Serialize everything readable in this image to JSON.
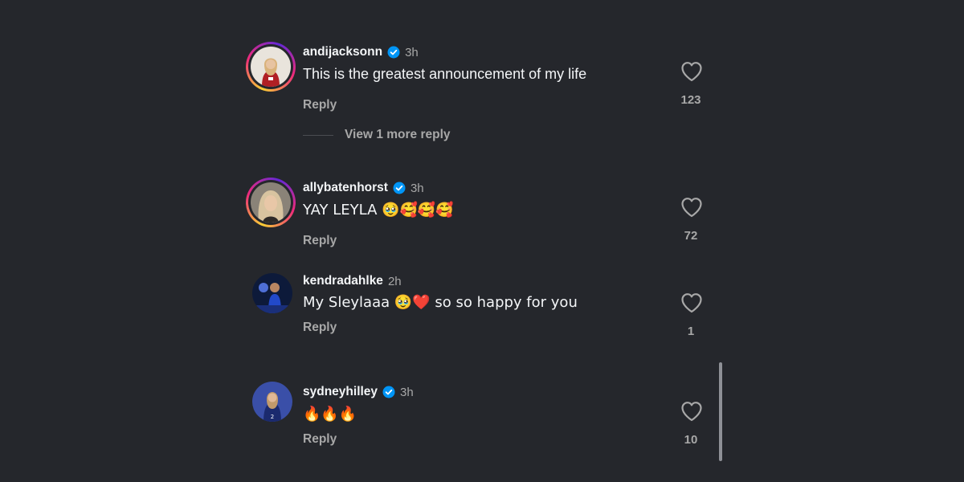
{
  "comments": [
    {
      "username": "andijacksonn",
      "verified": true,
      "time": "3h",
      "text": "This is the greatest announcement of my life",
      "reply_label": "Reply",
      "likes": "123",
      "view_more": "View 1 more reply"
    },
    {
      "username": "allybatenhorst",
      "verified": true,
      "time": "3h",
      "text": "YAY LEYLA 🥹🥰🥰🥰",
      "reply_label": "Reply",
      "likes": "72"
    },
    {
      "username": "kendradahlke",
      "verified": false,
      "time": "2h",
      "text": "My Sleylaaa 🥹❤️ so so happy for you",
      "reply_label": "Reply",
      "likes": "1"
    },
    {
      "username": "sydneyhilley",
      "verified": true,
      "time": "3h",
      "text": "🔥🔥🔥",
      "reply_label": "Reply",
      "likes": "10"
    }
  ],
  "colors": {
    "background": "#25272c",
    "verified_blue": "#0095f6",
    "muted_text": "#a8a8a8"
  },
  "icons": {
    "like": "heart-outline-icon",
    "verified": "verified-badge-icon"
  }
}
